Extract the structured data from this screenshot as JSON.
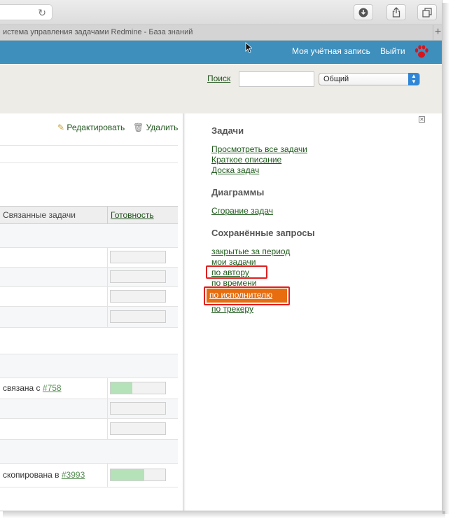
{
  "browser": {
    "tab_title": "истема управления задачами Redmine - База знаний",
    "reload_icon": "reload-icon",
    "download_icon": "download-icon",
    "share_icon": "share-icon",
    "tabs_icon": "tabs-icon",
    "newtab_label": "+"
  },
  "topmenu": {
    "account": "Моя учётная запись",
    "logout": "Выйти",
    "logo_icon": "paw-icon",
    "color": "#3e8fbc"
  },
  "header": {
    "search_label": "Поиск",
    "search_value": "",
    "scope_value": "Общий"
  },
  "content": {
    "edit_label": "Редактировать",
    "delete_label": "Удалить",
    "columns": [
      "Связанные задачи",
      "Готовность"
    ],
    "rows": [
      {
        "related": "",
        "link": "",
        "progress": 0
      },
      {
        "related": "",
        "link": "",
        "progress": 0
      },
      {
        "related": "",
        "link": "",
        "progress": 0
      },
      {
        "related": "",
        "link": "",
        "progress": 0
      },
      {
        "related": "связана с",
        "link": "#758",
        "progress": 40
      },
      {
        "related": "",
        "link": "",
        "progress": 0
      },
      {
        "related": "",
        "link": "",
        "progress": 0
      },
      {
        "related": "скопирована в",
        "link": "#3993",
        "progress": 60
      }
    ]
  },
  "sidebar": {
    "issues_title": "Задачи",
    "issues_links": [
      "Просмотреть все задачи",
      "Краткое описание",
      "Доска задач"
    ],
    "charts_title": "Диаграммы",
    "charts_links": [
      "Сгорание задач"
    ],
    "queries_title": "Сохранённые запросы",
    "queries_links": [
      "закрытые за период",
      "мои задачи",
      "по автору",
      "по времени",
      "по исполнителю",
      "по трекеру"
    ],
    "active_query": "по исполнителю",
    "highlight_color": "#e02020",
    "active_color": "#e76d0e"
  }
}
